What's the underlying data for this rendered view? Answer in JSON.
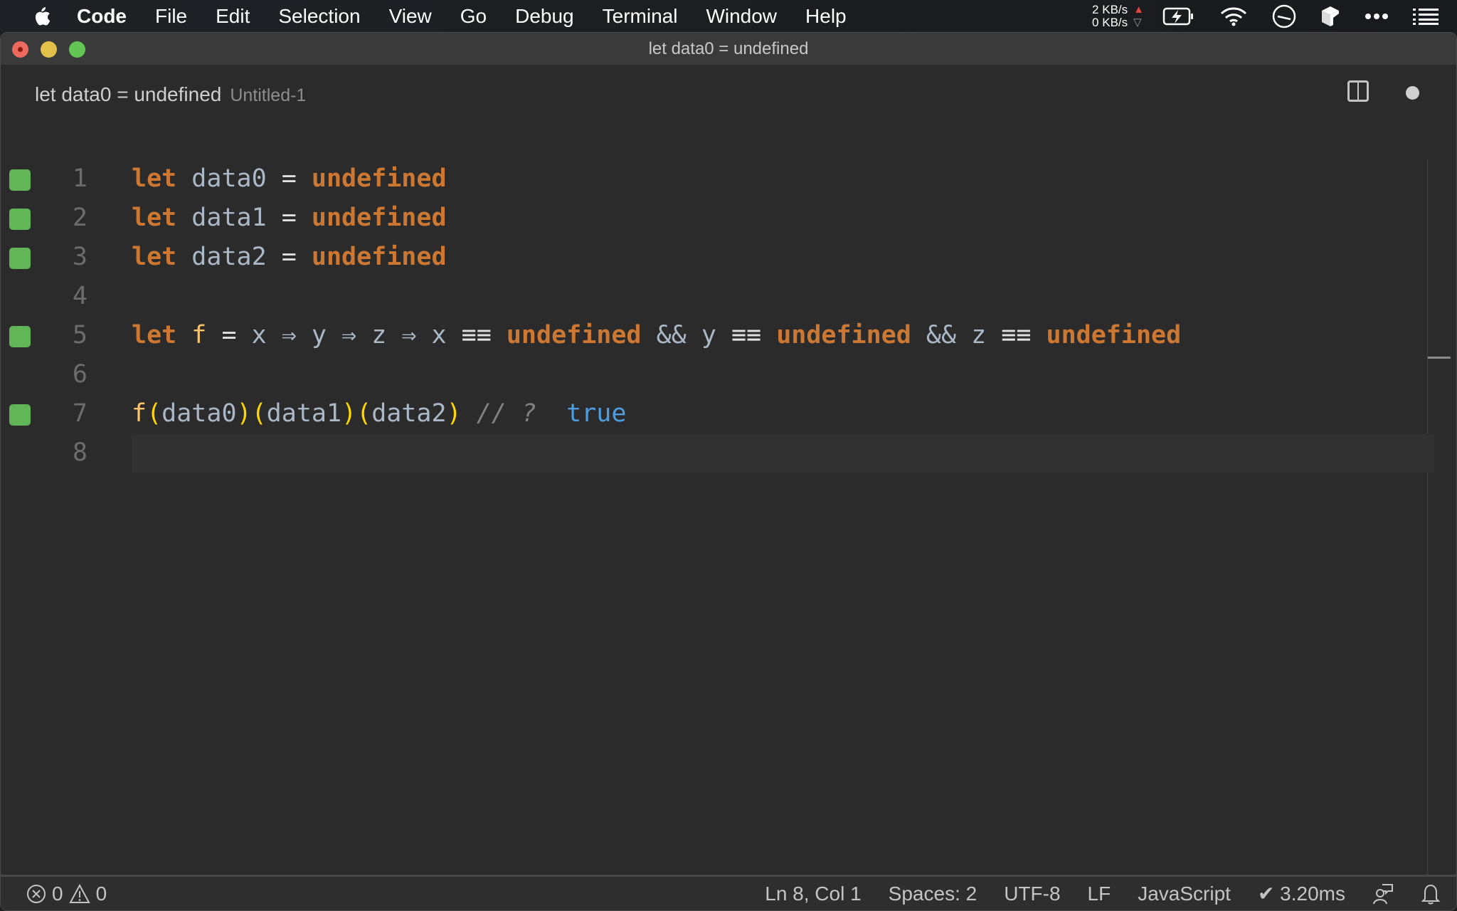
{
  "menubar": {
    "apple_icon": "apple-logo-icon",
    "items": [
      {
        "label": "Code",
        "bold": true
      },
      {
        "label": "File"
      },
      {
        "label": "Edit"
      },
      {
        "label": "Selection"
      },
      {
        "label": "View"
      },
      {
        "label": "Go"
      },
      {
        "label": "Debug"
      },
      {
        "label": "Terminal"
      },
      {
        "label": "Window"
      },
      {
        "label": "Help"
      }
    ],
    "tray": {
      "upload_speed": "2 KB/s",
      "download_speed": "0 KB/s",
      "icons": [
        "battery-charging-icon",
        "wifi-icon",
        "clock-icon",
        "app-box-icon",
        "more-icon",
        "list-icon"
      ]
    }
  },
  "window": {
    "title": "let data0 = undefined",
    "controls": [
      "close",
      "minimize",
      "maximize"
    ]
  },
  "tab": {
    "title": "let data0 = undefined",
    "subtitle": "Untitled-1",
    "split_icon": "split-editor-icon",
    "dirty_indicator": "unsaved-dot-icon"
  },
  "editor": {
    "colors": {
      "keyword": "#cc7832",
      "function": "#ffc66d",
      "identifier": "#a9b7c6",
      "bracket": "#ffd700",
      "comment": "#808080",
      "result": "#4d9de0",
      "gutter_mark": "#62b658"
    },
    "lines": [
      {
        "num": "1",
        "marker": true,
        "tokens": [
          {
            "t": "let",
            "c": "kw"
          },
          {
            "t": " ",
            "c": "id"
          },
          {
            "t": "data0",
            "c": "id"
          },
          {
            "t": " = ",
            "c": "op"
          },
          {
            "t": "undefined",
            "c": "kw"
          }
        ]
      },
      {
        "num": "2",
        "marker": true,
        "tokens": [
          {
            "t": "let",
            "c": "kw"
          },
          {
            "t": " ",
            "c": "id"
          },
          {
            "t": "data1",
            "c": "id"
          },
          {
            "t": " = ",
            "c": "op"
          },
          {
            "t": "undefined",
            "c": "kw"
          }
        ]
      },
      {
        "num": "3",
        "marker": true,
        "tokens": [
          {
            "t": "let",
            "c": "kw"
          },
          {
            "t": " ",
            "c": "id"
          },
          {
            "t": "data2",
            "c": "id"
          },
          {
            "t": " = ",
            "c": "op"
          },
          {
            "t": "undefined",
            "c": "kw"
          }
        ]
      },
      {
        "num": "4",
        "marker": false,
        "tokens": []
      },
      {
        "num": "5",
        "marker": true,
        "tokens": [
          {
            "t": "let",
            "c": "kw"
          },
          {
            "t": " ",
            "c": "id"
          },
          {
            "t": "f",
            "c": "fn"
          },
          {
            "t": " = ",
            "c": "op"
          },
          {
            "t": "x",
            "c": "id"
          },
          {
            "t": " ⇒ ",
            "c": "id"
          },
          {
            "t": "y",
            "c": "id"
          },
          {
            "t": " ⇒ ",
            "c": "id"
          },
          {
            "t": "z",
            "c": "id"
          },
          {
            "t": " ⇒ ",
            "c": "id"
          },
          {
            "t": "x",
            "c": "id"
          },
          {
            "t": " ≡≡ ",
            "c": "op"
          },
          {
            "t": "undefined",
            "c": "kw"
          },
          {
            "t": " && ",
            "c": "id"
          },
          {
            "t": "y",
            "c": "id"
          },
          {
            "t": " ≡≡ ",
            "c": "op"
          },
          {
            "t": "undefined",
            "c": "kw"
          },
          {
            "t": " && ",
            "c": "id"
          },
          {
            "t": "z",
            "c": "id"
          },
          {
            "t": " ≡≡ ",
            "c": "op"
          },
          {
            "t": "undefined",
            "c": "kw"
          }
        ]
      },
      {
        "num": "6",
        "marker": false,
        "tokens": []
      },
      {
        "num": "7",
        "marker": true,
        "tokens": [
          {
            "t": "f",
            "c": "fn"
          },
          {
            "t": "(",
            "c": "paren"
          },
          {
            "t": "data0",
            "c": "id"
          },
          {
            "t": ")",
            "c": "paren"
          },
          {
            "t": "(",
            "c": "paren"
          },
          {
            "t": "data1",
            "c": "id"
          },
          {
            "t": ")",
            "c": "paren"
          },
          {
            "t": "(",
            "c": "paren"
          },
          {
            "t": "data2",
            "c": "id"
          },
          {
            "t": ")",
            "c": "paren"
          },
          {
            "t": " // ? ",
            "c": "cmt"
          },
          {
            "t": " true",
            "c": "res"
          }
        ]
      },
      {
        "num": "8",
        "marker": false,
        "current": true,
        "tokens": []
      }
    ]
  },
  "statusbar": {
    "errors": "0",
    "warnings": "0",
    "cursor": "Ln 8, Col 1",
    "indent": "Spaces: 2",
    "encoding": "UTF-8",
    "eol": "LF",
    "language": "JavaScript",
    "quokka_time": "✔ 3.20ms",
    "feedback_icon": "feedback-person-icon",
    "bell_icon": "notification-bell-icon"
  }
}
